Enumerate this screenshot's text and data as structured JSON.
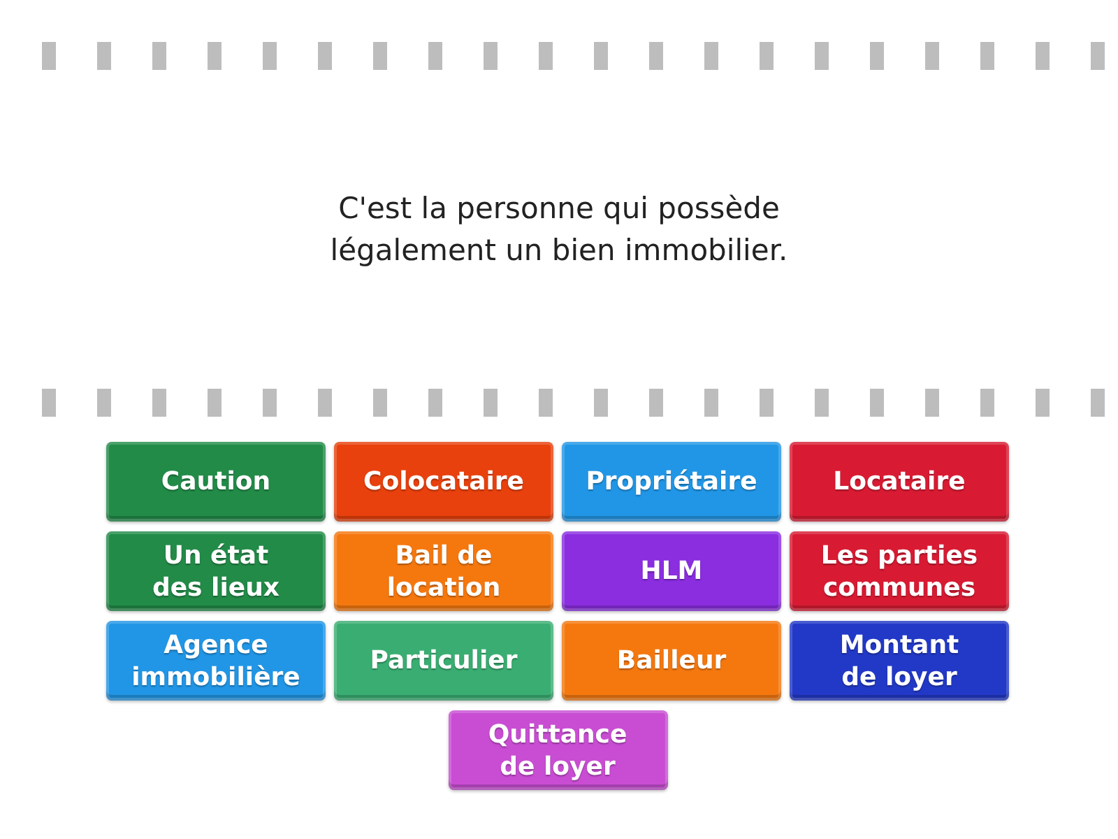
{
  "question": {
    "text": "C'est la personne qui possède légalement un bien immobilier."
  },
  "tiles": [
    {
      "label": "Caution",
      "color": "#228b48"
    },
    {
      "label": "Colocataire",
      "color": "#e8410d"
    },
    {
      "label": "Propriétaire",
      "color": "#2196e6"
    },
    {
      "label": "Locataire",
      "color": "#d81b33"
    },
    {
      "label": "Un état des lieux",
      "color": "#228b48"
    },
    {
      "label": "Bail de location",
      "color": "#f5780f"
    },
    {
      "label": "HLM",
      "color": "#8a2ee0"
    },
    {
      "label": "Les parties communes",
      "color": "#d81b33"
    },
    {
      "label": "Agence immobilière",
      "color": "#2196e6"
    },
    {
      "label": "Particulier",
      "color": "#3aae72"
    },
    {
      "label": "Bailleur",
      "color": "#f5780f"
    },
    {
      "label": "Montant de loyer",
      "color": "#2239c7"
    },
    {
      "label": "Quittance de loyer",
      "color": "#c94dd3"
    }
  ]
}
